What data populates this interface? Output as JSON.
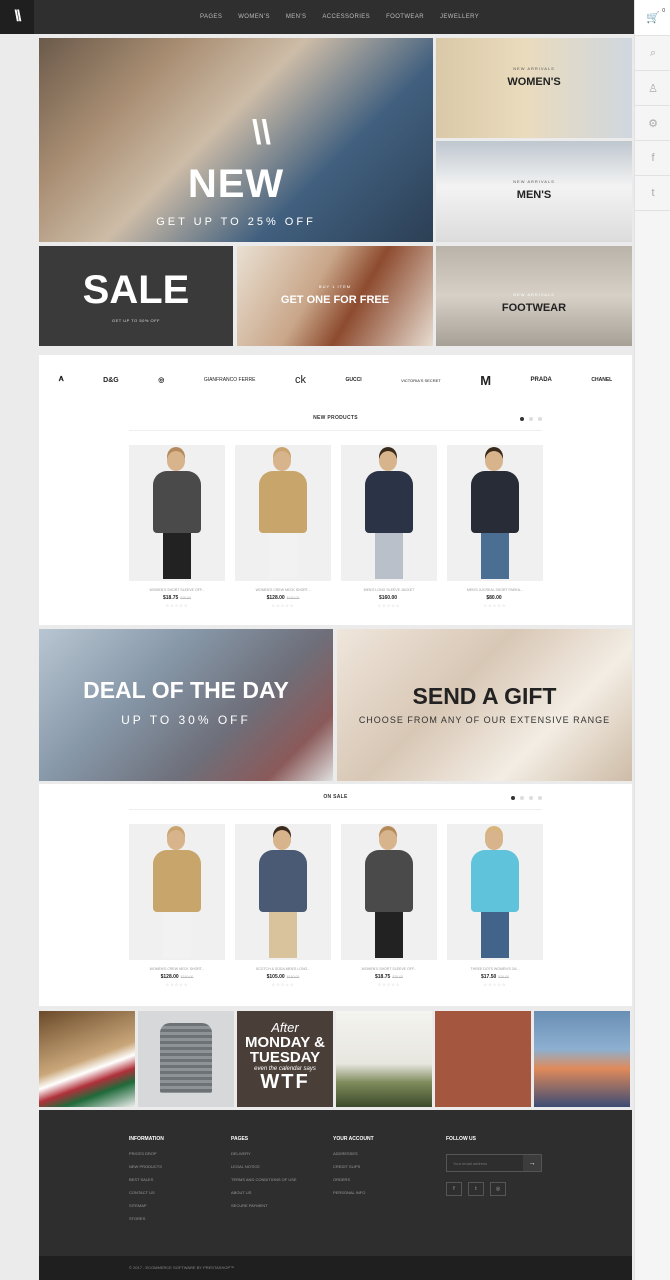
{
  "header": {
    "logo": "\\\\",
    "nav": [
      "PAGES",
      "WOMEN'S",
      "MEN'S",
      "ACCESSORIES",
      "FOOTWEAR",
      "JEWELLERY"
    ]
  },
  "rail": {
    "cart_count": "0"
  },
  "banners": {
    "new": {
      "title": "NEW",
      "subtitle": "GET UP TO 25% OFF"
    },
    "women": {
      "pre": "NEW ARRIVALS",
      "title": "WOMEN'S"
    },
    "men": {
      "pre": "NEW ARRIVALS",
      "title": "MEN'S"
    },
    "sale": {
      "title": "SALE",
      "subtitle": "GET UP TO 50% OFF"
    },
    "free": {
      "pre": "BUY 1 ITEM",
      "title": "GET ONE FOR FREE"
    },
    "footwear": {
      "pre": "NEW ARRIVALS",
      "title": "FOOTWEAR"
    }
  },
  "brands": [
    "ARMANI",
    "D&G",
    "VERSACE",
    "GIANFRANCO FERRE",
    "ck",
    "GUCCI",
    "VICTORIA'S SECRET",
    "M",
    "PRADA",
    "CHANEL"
  ],
  "new_products": {
    "title": "NEW PRODUCTS",
    "items": [
      {
        "name": "WOMEN'S SHORT SLEEVE OFF...",
        "price": "$18.75",
        "old_price": "$25.00",
        "top": "#4a4a4a",
        "bottom": "#222",
        "hair": "#b58a5a"
      },
      {
        "name": "WOMEN'S CREW NECK SHORT...",
        "price": "$128.00",
        "old_price": "$160.00",
        "top": "#c8a56a",
        "bottom": "#f2f2f2",
        "hair": "#c9a46e"
      },
      {
        "name": "MEN'S LONG SLEEVE JACKET",
        "price": "$160.00",
        "old_price": "",
        "top": "#2b3446",
        "bottom": "#b9c0c9",
        "hair": "#3a2a1c"
      },
      {
        "name": "MEN'S JUCREAL SHORT PARKA...",
        "price": "$80.00",
        "old_price": "",
        "top": "#272c36",
        "bottom": "#4a6f93",
        "hair": "#3a2a1c"
      }
    ]
  },
  "promos": {
    "deal": {
      "title": "DEAL OF THE DAY",
      "subtitle": "UP TO 30% OFF"
    },
    "gift": {
      "title": "SEND A GIFT",
      "subtitle": "CHOOSE FROM ANY OF OUR EXTENSIVE RANGE"
    }
  },
  "on_sale": {
    "title": "ON SALE",
    "items": [
      {
        "name": "WOMEN'S CREW NECK SHORT...",
        "price": "$128.00",
        "old_price": "$160.00",
        "top": "#c8a56a",
        "bottom": "#f2f2f2",
        "hair": "#c9a46e"
      },
      {
        "name": "SCOTCH & SODA MEN'S LONG...",
        "price": "$105.00",
        "old_price": "$150.00",
        "top": "#4a5a74",
        "bottom": "#d8c39c",
        "hair": "#3a2a1c"
      },
      {
        "name": "WOMEN'S SHORT SLEEVE OFF...",
        "price": "$18.75",
        "old_price": "$25.00",
        "top": "#4a4a4a",
        "bottom": "#222",
        "hair": "#b58a5a"
      },
      {
        "name": "THREE DOTS WOMEN'S 3/4...",
        "price": "$17.50",
        "old_price": "$25.00",
        "top": "#5fc3dc",
        "bottom": "#42648a",
        "hair": "#d6b47a"
      }
    ]
  },
  "tiles": {
    "wtf": [
      "After",
      "MONDAY &",
      "TUESDAY",
      "even the calendar says",
      "WTF"
    ]
  },
  "footer": {
    "columns": [
      {
        "title": "INFORMATION",
        "links": [
          "PRICES DROP",
          "NEW PRODUCTS",
          "BEST SALES",
          "CONTACT US",
          "SITEMAP",
          "STORES"
        ]
      },
      {
        "title": "PAGES",
        "links": [
          "DELIVERY",
          "LEGAL NOTICE",
          "TERMS AND CONDITIONS OF USE",
          "ABOUT US",
          "SECURE PAYMENT"
        ]
      },
      {
        "title": "YOUR ACCOUNT",
        "links": [
          "ADDRESSES",
          "CREDIT SLIPS",
          "ORDERS",
          "PERSONAL INFO"
        ]
      }
    ],
    "follow_title": "FOLLOW US",
    "email_placeholder": "Your email address",
    "copyright": "© 2017 - ECOMMERCE SOFTWARE BY PRESTASHOP™"
  }
}
